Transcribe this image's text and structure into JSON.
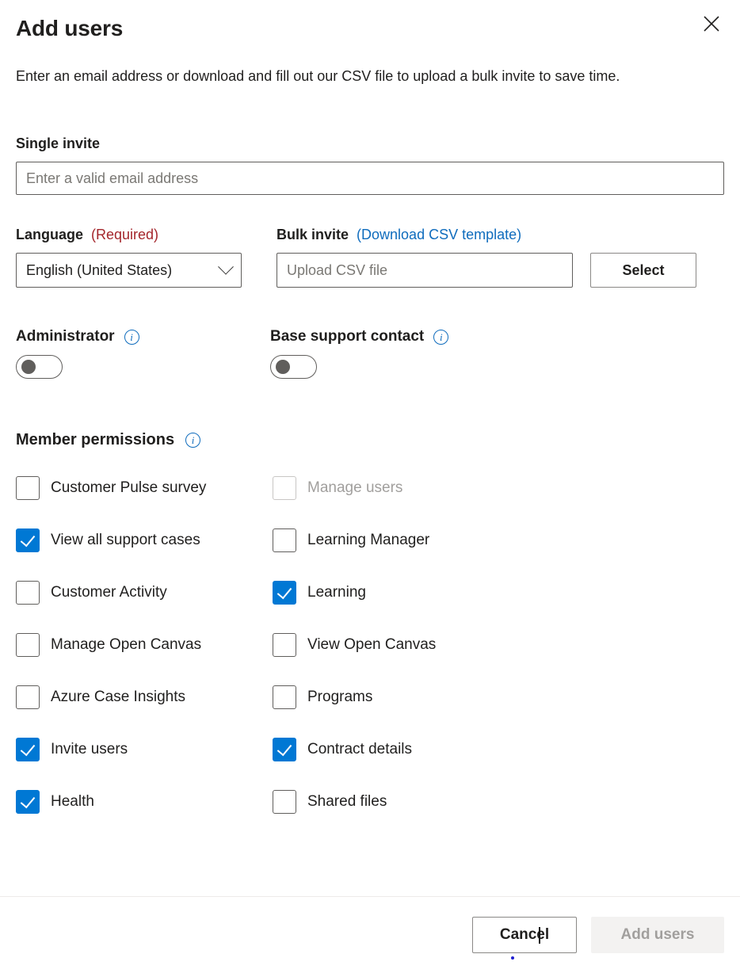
{
  "dialog": {
    "title": "Add users",
    "close_icon": "close-icon",
    "intro": "Enter an email address or download and fill out our CSV file to upload a bulk invite to save time."
  },
  "single_invite": {
    "label": "Single invite",
    "placeholder": "Enter a valid email address",
    "value": ""
  },
  "language": {
    "label": "Language",
    "required_text": "(Required)",
    "selected": "English (United States)",
    "chevron_icon": "chevron-down-icon"
  },
  "bulk_invite": {
    "label": "Bulk invite",
    "download_link": "(Download CSV template)",
    "placeholder": "Upload CSV file",
    "value": "",
    "select_button": "Select"
  },
  "toggles": [
    {
      "label": "Administrator",
      "state": "off",
      "info_icon": "info-icon"
    },
    {
      "label": "Base support contact",
      "state": "off",
      "info_icon": "info-icon"
    }
  ],
  "permissions": {
    "title": "Member permissions",
    "info_icon": "info-icon",
    "items": [
      {
        "label": "Customer Pulse survey",
        "checked": false,
        "disabled": false,
        "column": "left"
      },
      {
        "label": "Manage users",
        "checked": false,
        "disabled": true,
        "column": "right"
      },
      {
        "label": "View all support cases",
        "checked": true,
        "disabled": false,
        "column": "left"
      },
      {
        "label": "Learning Manager",
        "checked": false,
        "disabled": false,
        "column": "right"
      },
      {
        "label": "Customer Activity",
        "checked": false,
        "disabled": false,
        "column": "left"
      },
      {
        "label": "Learning",
        "checked": true,
        "disabled": false,
        "column": "right"
      },
      {
        "label": "Manage Open Canvas",
        "checked": false,
        "disabled": false,
        "column": "left"
      },
      {
        "label": "View Open Canvas",
        "checked": false,
        "disabled": false,
        "column": "right"
      },
      {
        "label": "Azure Case Insights",
        "checked": false,
        "disabled": false,
        "column": "left"
      },
      {
        "label": "Programs",
        "checked": false,
        "disabled": false,
        "column": "right"
      },
      {
        "label": "Invite users",
        "checked": true,
        "disabled": false,
        "column": "left"
      },
      {
        "label": "Contract details",
        "checked": true,
        "disabled": false,
        "column": "right"
      },
      {
        "label": "Health",
        "checked": true,
        "disabled": false,
        "column": "left"
      },
      {
        "label": "Shared files",
        "checked": false,
        "disabled": false,
        "column": "right"
      }
    ]
  },
  "footer": {
    "cancel_label": "Cancel",
    "submit_label": "Add users",
    "submit_enabled": false
  },
  "colors": {
    "accent": "#0078D4",
    "link": "#0F6CBD",
    "required": "#A4262C",
    "disabled_text": "#A19F9D",
    "disabled_bg": "#F3F2F1",
    "border": "#605E5C"
  }
}
